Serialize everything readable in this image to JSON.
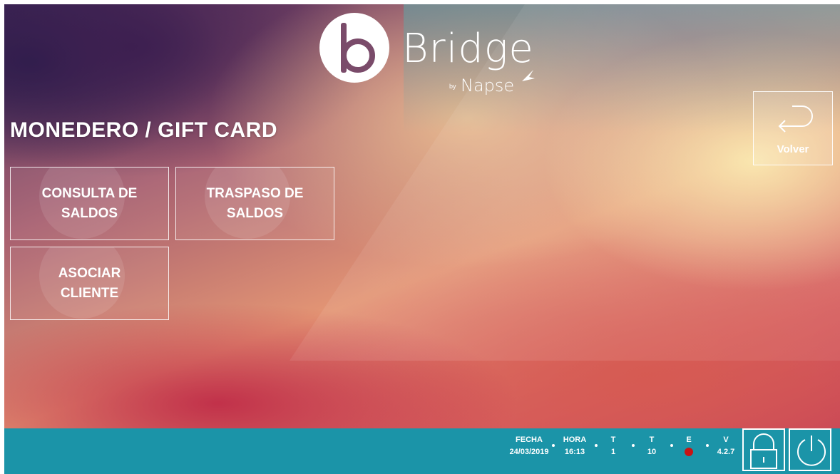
{
  "app": {
    "logo_word": "Bridge",
    "logo_by": "by",
    "logo_sub": "Napse"
  },
  "page_title": "MONEDERO / GIFT CARD",
  "tiles": [
    {
      "label": "CONSULTA DE\nSALDOS"
    },
    {
      "label": "TRASPASO DE\nSALDOS"
    },
    {
      "label": "ASOCIAR\nCLIENTE"
    }
  ],
  "back_button": {
    "label": "Volver",
    "icon": "return-arrow-icon"
  },
  "status": {
    "fecha_label": "FECHA",
    "fecha_value": "24/03/2019",
    "hora_label": "HORA",
    "hora_value": "16:13",
    "t1_label": "T",
    "t1_value": "1",
    "t2_label": "T",
    "t2_value": "10",
    "e_label": "E",
    "e_status_color": "#c81414",
    "v_label": "V",
    "v_value": "4.2.7"
  },
  "actions": [
    {
      "icon": "lock-icon"
    },
    {
      "icon": "power-icon"
    }
  ],
  "colors": {
    "statusbar": "#1b94a8",
    "error": "#c81414"
  }
}
